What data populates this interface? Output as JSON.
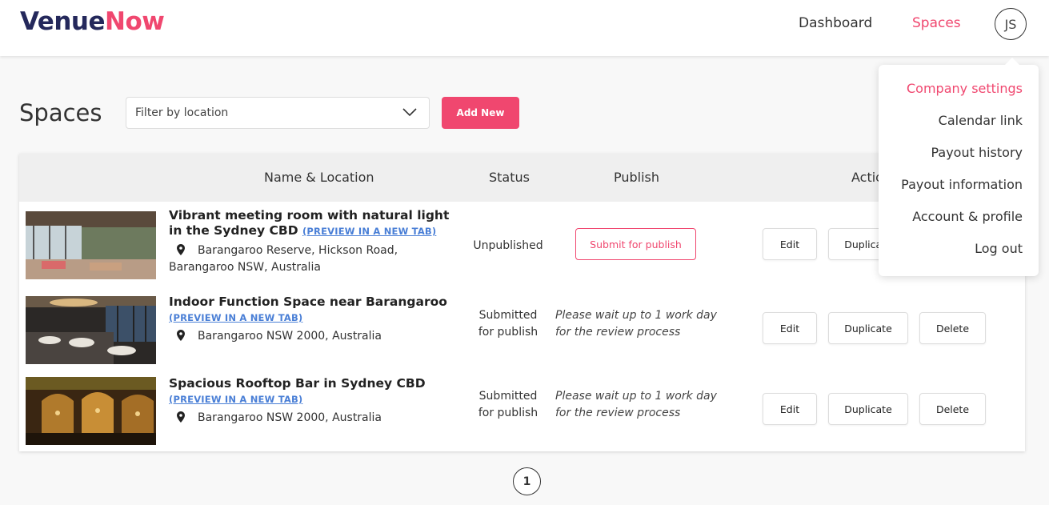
{
  "brand": {
    "part1": "Venue",
    "part2": "Now"
  },
  "nav": {
    "dashboard": "Dashboard",
    "spaces": "Spaces",
    "avatar_initials": "JS"
  },
  "page": {
    "title": "Spaces"
  },
  "filter": {
    "placeholder": "Filter by location"
  },
  "add_button": "Add New",
  "table": {
    "headers": {
      "name_location": "Name & Location",
      "status": "Status",
      "publish": "Publish",
      "actions": "Actions"
    },
    "rows": [
      {
        "title": "Vibrant meeting room with natural light in the Sydney CBD",
        "preview": "(PREVIEW IN A NEW TAB)",
        "address": "Barangaroo Reserve, Hickson Road, Barangaroo NSW, Australia",
        "status": "Unpublished",
        "publish_button": "Submit for publish",
        "edit": "Edit",
        "duplicate": "Duplicate"
      },
      {
        "title": "Indoor Function Space near Barangaroo",
        "preview": "(PREVIEW IN A NEW TAB)",
        "address": "Barangaroo NSW 2000, Australia",
        "status_line1": "Submitted",
        "status_line2": "for publish",
        "note_line1": "Please wait up to 1 work day",
        "note_line2": "for the review process",
        "edit": "Edit",
        "duplicate": "Duplicate",
        "delete": "Delete"
      },
      {
        "title": "Spacious Rooftop Bar in Sydney CBD",
        "preview": "(PREVIEW IN A NEW TAB)",
        "address": "Barangaroo NSW 2000, Australia",
        "status_line1": "Submitted",
        "status_line2": "for publish",
        "note_line1": "Please wait up to 1 work day",
        "note_line2": "for the review process",
        "edit": "Edit",
        "duplicate": "Duplicate",
        "delete": "Delete"
      }
    ]
  },
  "pagination": {
    "current": "1"
  },
  "user_menu": {
    "items": [
      "Company settings",
      "Calendar link",
      "Payout history",
      "Payout information",
      "Account & profile",
      "Log out"
    ],
    "active_index": 0
  },
  "colors": {
    "accent": "#f0476f",
    "brand_dark": "#24285b",
    "link": "#4a7fd6"
  },
  "icons": {
    "pin": "map-pin-icon",
    "chevron": "chevron-down-icon"
  }
}
